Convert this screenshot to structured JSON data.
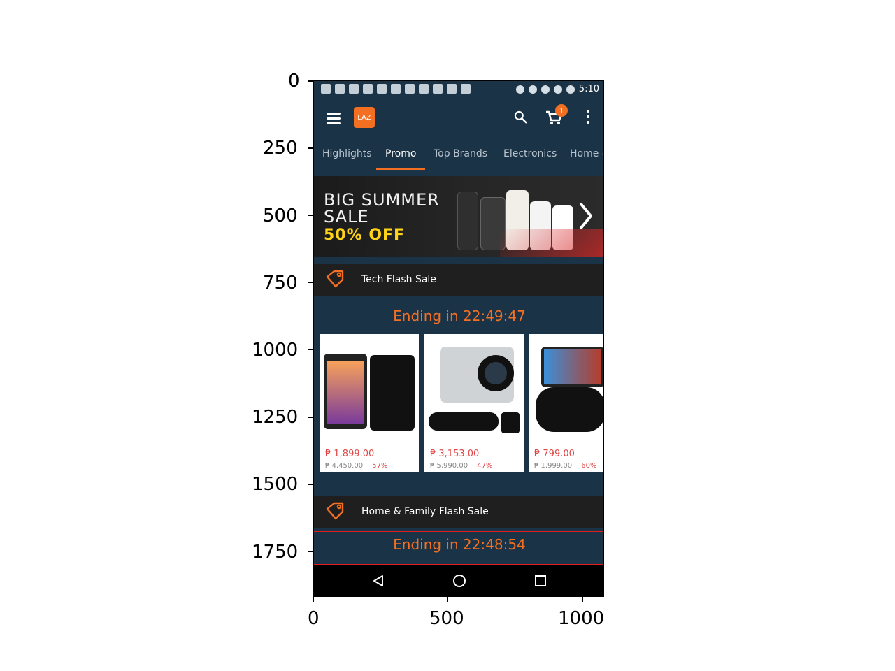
{
  "axes": {
    "y_ticks": [
      "0",
      "250",
      "500",
      "750",
      "1000",
      "1250",
      "1500",
      "1750"
    ],
    "x_ticks": [
      "0",
      "500",
      "1000"
    ]
  },
  "status_bar": {
    "time": "5:10"
  },
  "app_bar": {
    "logo_text": "LAZ",
    "cart_badge_count": "1",
    "icons": [
      "menu-icon",
      "lazada-logo",
      "search-icon",
      "cart-icon",
      "more-vert-icon"
    ]
  },
  "tabs": [
    {
      "label": "Highlights",
      "active": false
    },
    {
      "label": "Promo",
      "active": true
    },
    {
      "label": "Top Brands",
      "active": false
    },
    {
      "label": "Electronics",
      "active": false
    },
    {
      "label": "Home &",
      "active": false
    }
  ],
  "banner": {
    "line1": "BIG SUMMER",
    "line2": "SALE",
    "discount": "50% OFF"
  },
  "sections": [
    {
      "title": "Tech Flash Sale",
      "countdown": "Ending in 22:49:47",
      "products": [
        {
          "price": "₱ 1,899.00",
          "old_price": "₱ 4,450.00",
          "discount": "57%"
        },
        {
          "price": "₱ 3,153.00",
          "old_price": "₱ 5,990.00",
          "discount": "47%"
        },
        {
          "price": "₱ 799.00",
          "old_price": "₱ 1,999.00",
          "discount": "60%"
        }
      ]
    },
    {
      "title": "Home & Family Flash Sale",
      "countdown": "Ending in 22:48:54"
    }
  ],
  "colors": {
    "app_dark_blue": "#1b3347",
    "accent_orange": "#f36f21",
    "section_header": "#1f1f1f",
    "price_red": "#e04646",
    "banner_yellow": "#ffd31a"
  }
}
